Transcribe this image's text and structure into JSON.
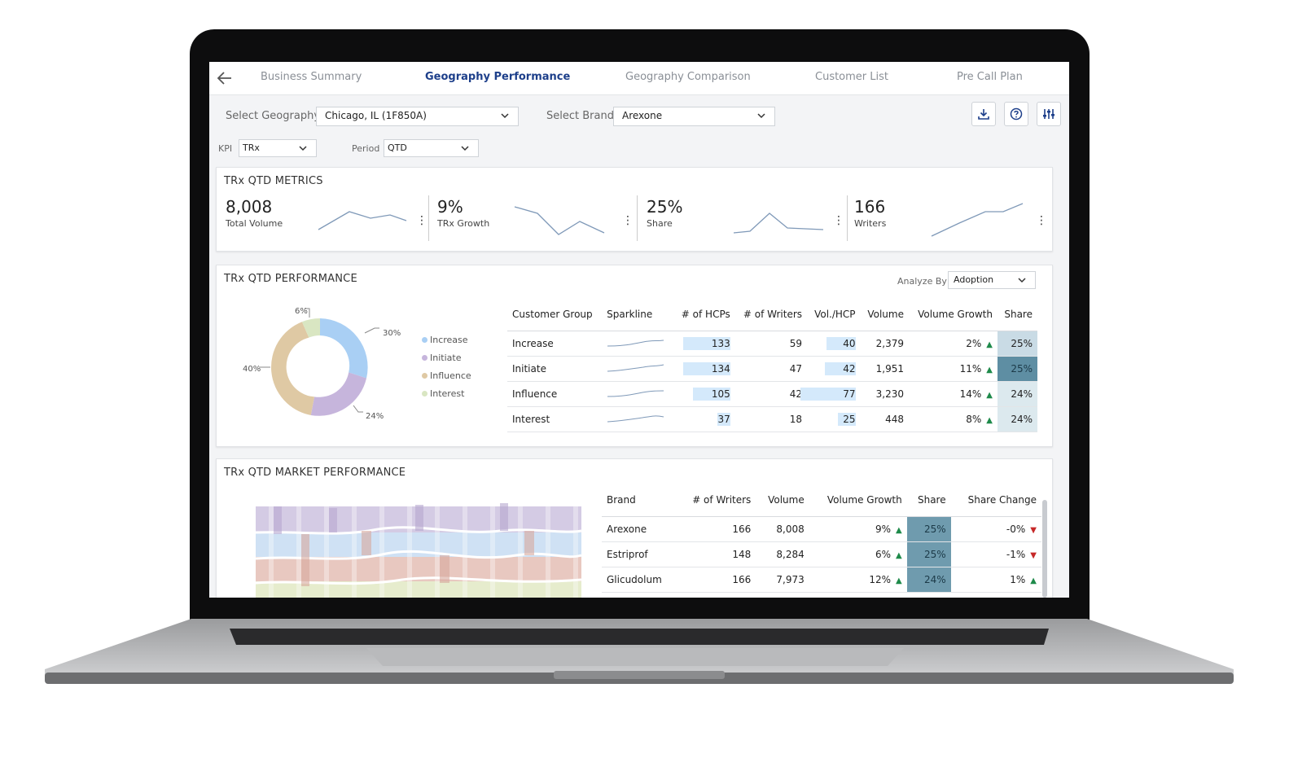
{
  "tabs": [
    "Business Summary",
    "Geography Performance",
    "Geography Comparison",
    "Customer List",
    "Pre Call Plan"
  ],
  "filters": {
    "geography_label": "Select Geography",
    "geography_value": "Chicago, IL (1F850A)",
    "brand_label": "Select Brand",
    "brand_value": "Arexone",
    "kpi_label": "KPI",
    "kpi_value": "TRx",
    "period_label": "Period",
    "period_value": "QTD"
  },
  "metrics": {
    "title": "TRx QTD METRICS",
    "items": [
      {
        "value": "8,008",
        "label": "Total Volume"
      },
      {
        "value": "9%",
        "label": "TRx Growth"
      },
      {
        "value": "25%",
        "label": "Share"
      },
      {
        "value": "166",
        "label": "Writers"
      }
    ]
  },
  "performance": {
    "title": "TRx QTD PERFORMANCE",
    "analyze_label": "Analyze By",
    "analyze_value": "Adoption",
    "donut_labels": [
      "30%",
      "24%",
      "40%",
      "6%"
    ],
    "legend": [
      "Increase",
      "Initiate",
      "Influence",
      "Interest"
    ],
    "columns": [
      "Customer Group",
      "Sparkline",
      "# of HCPs",
      "# of Writers",
      "Vol./HCP",
      "Volume",
      "Volume Growth",
      "Share"
    ],
    "rows": [
      {
        "group": "Increase",
        "hcps": "133",
        "writers": "59",
        "vol_hcp": "40",
        "volume": "2,379",
        "growth": "2%",
        "share": "25%"
      },
      {
        "group": "Initiate",
        "hcps": "134",
        "writers": "47",
        "vol_hcp": "42",
        "volume": "1,951",
        "growth": "11%",
        "share": "25%"
      },
      {
        "group": "Influence",
        "hcps": "105",
        "writers": "42",
        "vol_hcp": "77",
        "volume": "3,230",
        "growth": "14%",
        "share": "24%"
      },
      {
        "group": "Interest",
        "hcps": "37",
        "writers": "18",
        "vol_hcp": "25",
        "volume": "448",
        "growth": "8%",
        "share": "24%"
      }
    ]
  },
  "market": {
    "title": "TRx QTD MARKET PERFORMANCE",
    "columns": [
      "Brand",
      "# of Writers",
      "Volume",
      "Volume Growth",
      "Share",
      "Share Change"
    ],
    "rows": [
      {
        "brand": "Arexone",
        "writers": "166",
        "volume": "8,008",
        "growth": "9%",
        "share": "25%",
        "change": "-0%"
      },
      {
        "brand": "Estriprof",
        "writers": "148",
        "volume": "8,284",
        "growth": "6%",
        "share": "25%",
        "change": "-1%"
      },
      {
        "brand": "Glicudolum",
        "writers": "166",
        "volume": "7,973",
        "growth": "12%",
        "share": "24%",
        "change": "1%"
      }
    ]
  },
  "colors": {
    "accent": "#1d3f8a",
    "increase": "#a9cff4",
    "initiate": "#c6b5dc",
    "influence": "#dfc9a4",
    "interest": "#d9e6c2"
  }
}
